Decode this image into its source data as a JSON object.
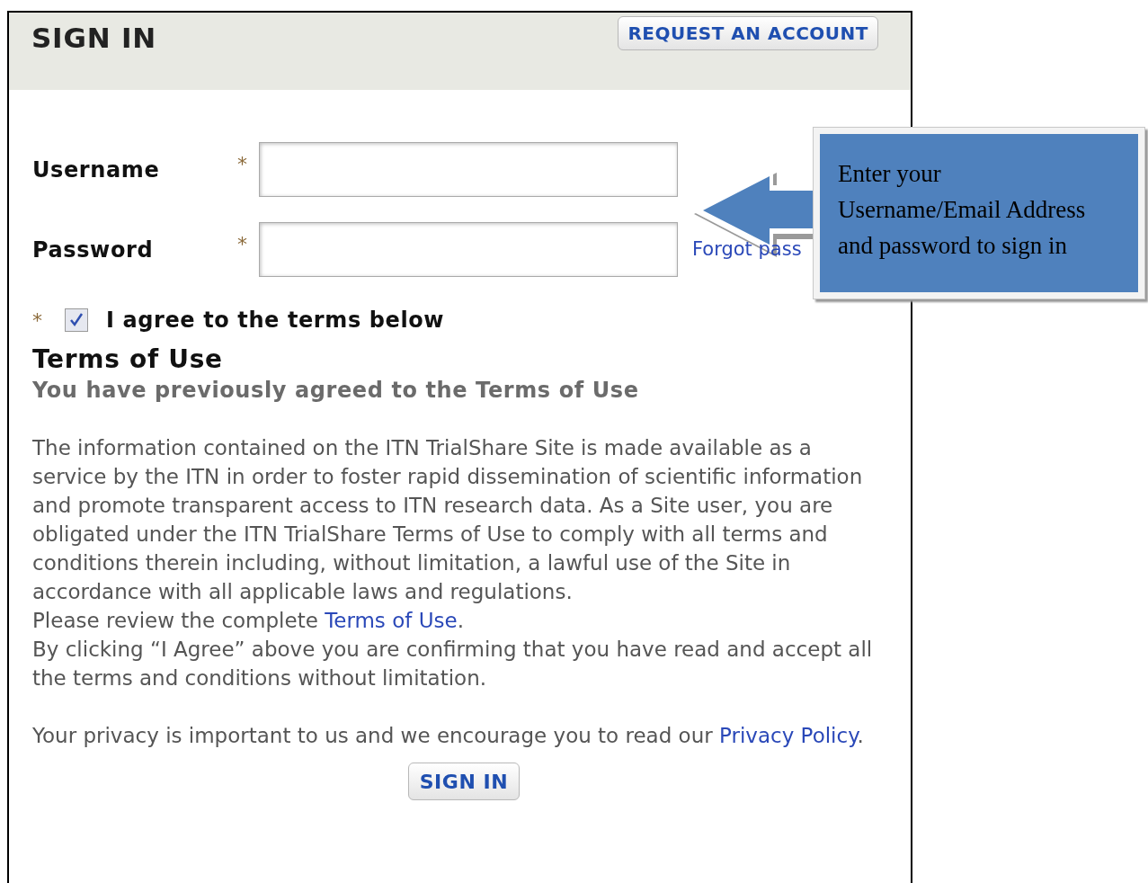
{
  "header": {
    "title": "SIGN IN",
    "request_button": "REQUEST AN ACCOUNT"
  },
  "fields": [
    {
      "label": "Username",
      "required_mark": "*"
    },
    {
      "label": "Password",
      "required_mark": "*",
      "link": "Forgot pass"
    }
  ],
  "agreement": {
    "required_mark": "*",
    "checked": true,
    "label": "I agree to the terms below"
  },
  "terms": {
    "title": "Terms of Use",
    "subtitle": "You have previously agreed to the Terms of Use",
    "body": "The information contained on the ITN TrialShare Site is made available as a service by the ITN in order to foster rapid dissemination of scientific information and promote transparent access to ITN research data. As a Site user, you are obligated under the ITN TrialShare Terms of Use to comply with all terms and conditions therein including, without limitation, a lawful use of the Site in accordance with all applicable laws and regulations.",
    "review_text": "Please review the complete",
    "review_link": "Terms of Use",
    "review_after": ".",
    "agreement_text": "By clicking “I Agree” above you are confirming that you have read and accept all the terms and conditions without limitation."
  },
  "privacy": {
    "text": "Your privacy is important to us and we encourage you to read our",
    "link": "Privacy Policy",
    "after": "."
  },
  "sign_in_button": "SIGN IN",
  "callout": {
    "lines": [
      "Enter your",
      "Username/Email Address",
      "and password to sign in"
    ]
  }
}
